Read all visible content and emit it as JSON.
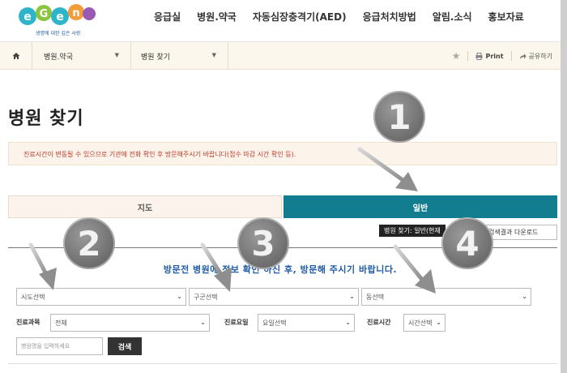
{
  "header": {
    "logo_slogan": "생명에 대한 깊은 사랑",
    "nav": [
      "응급실",
      "병원.약국",
      "자동심장충격기(AED)",
      "응급처치방법",
      "알림.소식",
      "홍보자료"
    ]
  },
  "breadcrumb": {
    "level1": "병원.약국",
    "level2": "병원 찾기"
  },
  "tools": {
    "print_label": "Print",
    "share_label": "공유하기"
  },
  "page": {
    "title": "병원 찾기",
    "notice": "진료시간이 변동될 수 있으므로 기관에 전화 확인 후 방문해주시기 바랍니다(접수 마감 시간 확인 등)."
  },
  "tabs": {
    "map": "지도",
    "general": "일반"
  },
  "tooltip": "병원 찾기: 일반(현재",
  "download_label": "검색결과 다운로드",
  "instruction": "방문전 병원에 정보 확인 하신 후, 방문해 주시기 바랍니다.",
  "form": {
    "sido": "시도선택",
    "gugun": "구군선택",
    "dong": "동선택",
    "dept_label": "진료과목",
    "dept_value": "전체",
    "day_label": "진료요일",
    "day_value": "요일선택",
    "time_label": "진료시간",
    "time_value": "시간선택",
    "name_placeholder": "병원명을 입력하세요",
    "search_button": "검색"
  },
  "badges": [
    "1",
    "2",
    "3",
    "4"
  ],
  "colors": {
    "tab_active": "#127d8e",
    "notice_text": "#c0392b",
    "instruction_text": "#1f5aa6",
    "breadcrumb_bg": "#fbf7ec"
  },
  "icons": [
    "home-icon",
    "star-icon",
    "print-icon",
    "share-icon",
    "chevron-down-icon"
  ]
}
